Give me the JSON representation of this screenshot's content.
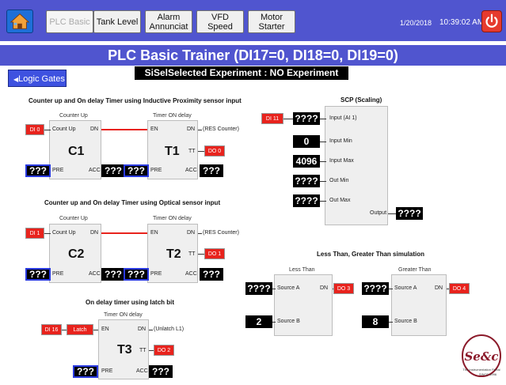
{
  "topbar": {
    "buttons": [
      {
        "label": "PLC Basic",
        "disabled": true
      },
      {
        "label": "Tank Level"
      },
      {
        "label": "Alarm Annunciat"
      },
      {
        "label": "VFD Speed"
      },
      {
        "label": "Motor Starter"
      }
    ],
    "date": "1/20/2018",
    "time": "10:39:02 AM",
    "home_icon": "home-icon",
    "power_icon": "power-icon"
  },
  "title": "PLC Basic Trainer (DI17=0, DI18=0, DI19=0)",
  "logic_button": "Logic Gates",
  "experiment_banner": "SiSelSelected Experiment : NO Experiment Selected",
  "sections": {
    "s1": {
      "title": "Counter up and On delay Timer using Inductive Proximity sensor input",
      "input_tag": "DI 0",
      "counter": {
        "title": "Counter Up",
        "in_label": "Count Up",
        "dn_label": "DN",
        "name": "C1",
        "pre_label": "PRE",
        "acc_label": "ACC",
        "pre_value": "???",
        "acc_value": "???"
      },
      "timer": {
        "title": "Timer ON delay",
        "en_label": "EN",
        "dn_label": "DN",
        "dn_note": "(RES Counter)",
        "name": "T1",
        "tt_label": "TT",
        "tt_output": "DO 0",
        "pre_label": "PRE",
        "acc_label": "ACC",
        "pre_value": "???",
        "acc_value": "???"
      }
    },
    "s2": {
      "title": "Counter up and On delay Timer using Optical sensor input",
      "input_tag": "DI 1",
      "counter": {
        "title": "Counter Up",
        "in_label": "Count Up",
        "dn_label": "DN",
        "name": "C2",
        "pre_label": "PRE",
        "acc_label": "ACC",
        "pre_value": "???",
        "acc_value": "???"
      },
      "timer": {
        "title": "Timer ON delay",
        "en_label": "EN",
        "dn_label": "DN",
        "dn_note": "(RES Counter)",
        "name": "T2",
        "tt_label": "TT",
        "tt_output": "DO 1",
        "pre_label": "PRE",
        "acc_label": "ACC",
        "pre_value": "???",
        "acc_value": "???"
      }
    },
    "s3": {
      "title": "On delay timer using latch bit",
      "input_tag": "DI 16",
      "latch_tag": "Latch",
      "timer": {
        "title": "Timer ON delay",
        "en_label": "EN",
        "dn_label": "DN",
        "dn_note": "(Unlatch L1)",
        "name": "T3",
        "tt_label": "TT",
        "tt_output": "DO 2",
        "pre_label": "PRE",
        "acc_label": "ACC",
        "pre_value": "???",
        "acc_value": "???"
      }
    },
    "scp": {
      "title": "SCP (Scaling)",
      "input_tag": "DI 11",
      "input_value": "????",
      "input_label": "Input (AI 1)",
      "in_min_value": "0",
      "in_min_label": "Input Min",
      "in_max_value": "4096",
      "in_max_label": "Input Max",
      "out_min_value": "????",
      "out_min_label": "Out Min",
      "out_max_value": "????",
      "out_max_label": "Out Max",
      "output_label": "Output",
      "output_value": "????"
    },
    "cmp": {
      "title": "Less Than, Greater Than simulation",
      "less": {
        "title": "Less Than",
        "src_a_label": "Source A",
        "src_b_label": "Source B",
        "dn_label": "DN",
        "src_a_value": "????",
        "src_b_value": "2",
        "output": "DO 3"
      },
      "greater": {
        "title": "Greater Than",
        "src_a_label": "Source A",
        "src_b_label": "Source B",
        "dn_label": "DN",
        "src_a_value": "????",
        "src_b_value": "8",
        "output": "DO 4"
      }
    }
  },
  "logo": {
    "monogram": "Se&c",
    "ring_text": "The Instrumentation Portal",
    "since": "SINCE 1996"
  }
}
